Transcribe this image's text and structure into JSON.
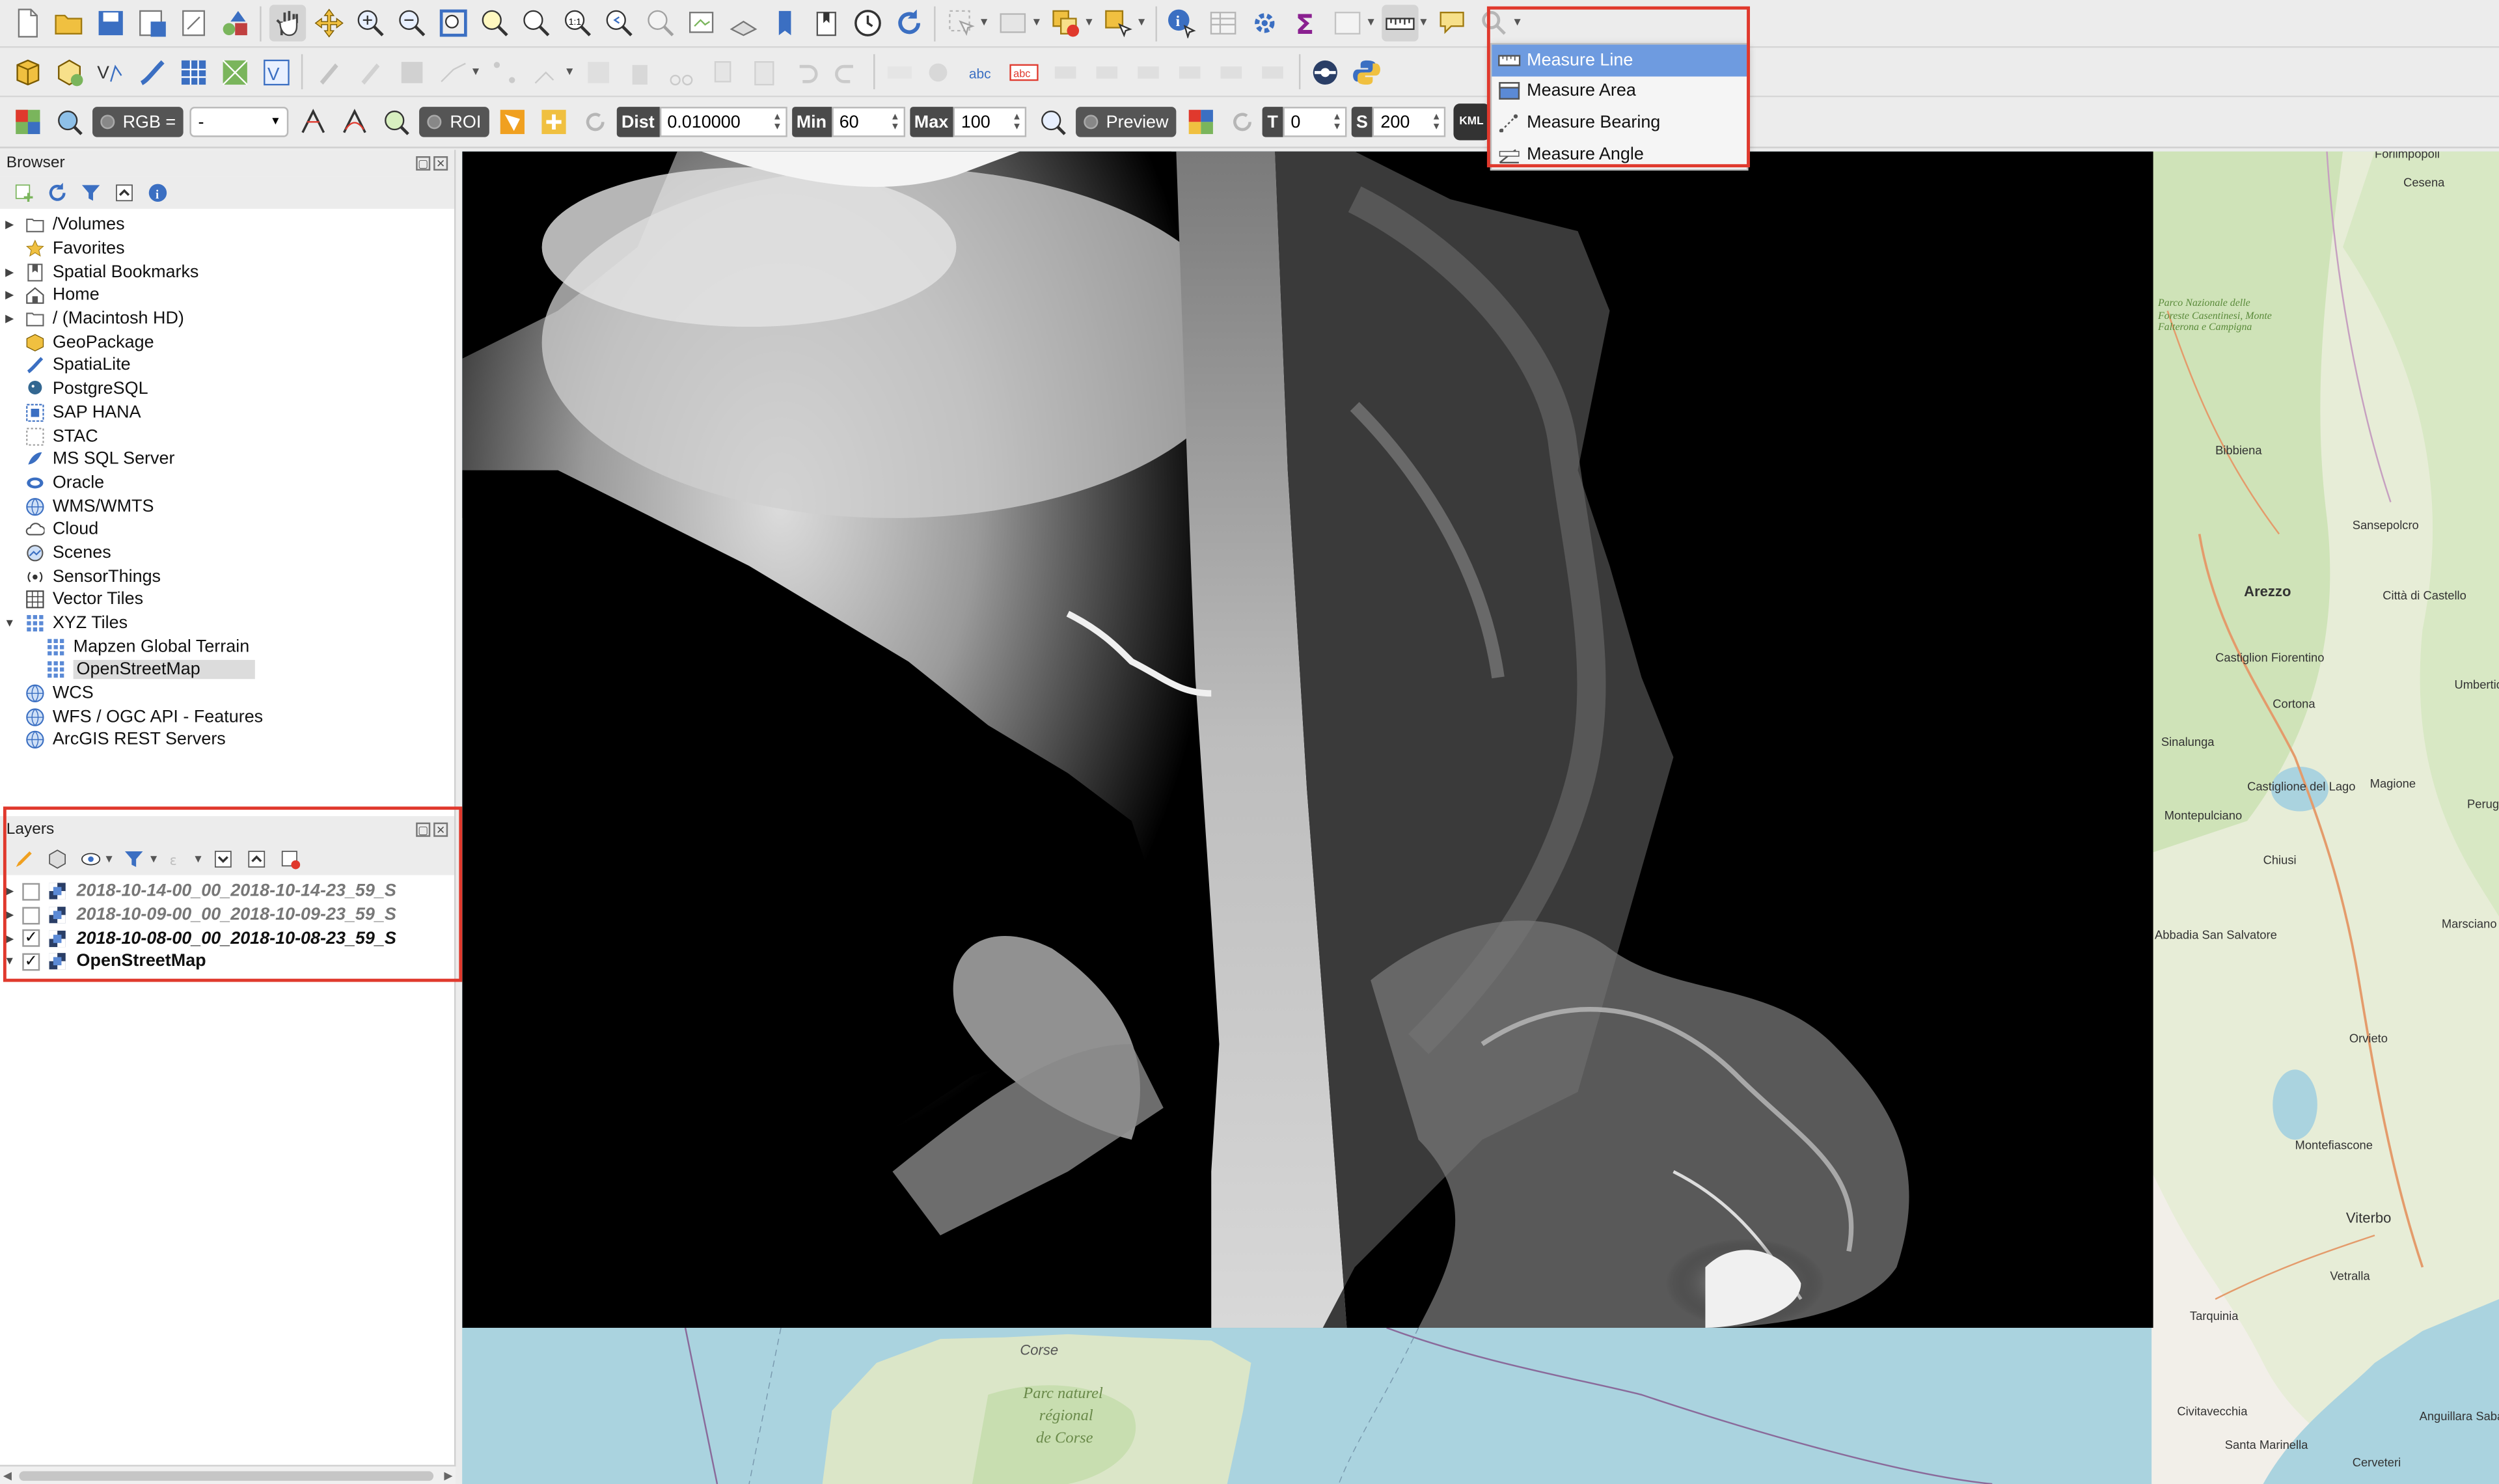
{
  "toolbar3": {
    "rgb_label": "RGB =",
    "rgb_value": "-",
    "roi_label": "ROI",
    "dist_label": "Dist",
    "dist_value": "0.010000",
    "min_label": "Min",
    "min_value": "60",
    "max_label": "Max",
    "max_value": "100",
    "preview_label": "Preview",
    "t_label": "T",
    "t_value": "0",
    "s_label": "S",
    "s_value": "200",
    "kml_label": "KML"
  },
  "measure_menu": {
    "items": [
      {
        "label": "Measure Line",
        "icon": "measure-line-icon",
        "highlighted": true
      },
      {
        "label": "Measure Area",
        "icon": "measure-area-icon"
      },
      {
        "label": "Measure Bearing",
        "icon": "measure-bearing-icon"
      },
      {
        "label": "Measure Angle",
        "icon": "measure-angle-icon"
      }
    ]
  },
  "browser": {
    "title": "Browser",
    "items": [
      {
        "label": "/Volumes",
        "icon": "folder-icon",
        "expandable": true
      },
      {
        "label": "Favorites",
        "icon": "star-icon",
        "expandable": false
      },
      {
        "label": "Spatial Bookmarks",
        "icon": "bookmark-icon",
        "expandable": true
      },
      {
        "label": "Home",
        "icon": "home-icon",
        "expandable": true
      },
      {
        "label": "/ (Macintosh HD)",
        "icon": "folder-icon",
        "expandable": true
      },
      {
        "label": "GeoPackage",
        "icon": "geopackage-icon",
        "expandable": false
      },
      {
        "label": "SpatiaLite",
        "icon": "spatialite-icon",
        "expandable": false
      },
      {
        "label": "PostgreSQL",
        "icon": "postgresql-icon",
        "expandable": false
      },
      {
        "label": "SAP HANA",
        "icon": "sap-hana-icon",
        "expandable": false
      },
      {
        "label": "STAC",
        "icon": "stac-icon",
        "expandable": false
      },
      {
        "label": "MS SQL Server",
        "icon": "mssql-icon",
        "expandable": false
      },
      {
        "label": "Oracle",
        "icon": "oracle-icon",
        "expandable": false
      },
      {
        "label": "WMS/WMTS",
        "icon": "globe-icon",
        "expandable": false
      },
      {
        "label": "Cloud",
        "icon": "cloud-icon",
        "expandable": false
      },
      {
        "label": "Scenes",
        "icon": "scenes-icon",
        "expandable": false
      },
      {
        "label": "SensorThings",
        "icon": "sensor-icon",
        "expandable": false
      },
      {
        "label": "Vector Tiles",
        "icon": "vector-tiles-icon",
        "expandable": false
      },
      {
        "label": "XYZ Tiles",
        "icon": "xyz-tiles-icon",
        "expandable": true,
        "expanded": true
      },
      {
        "label": "Mapzen Global Terrain",
        "icon": "xyz-tiles-icon",
        "child": true
      },
      {
        "label": "OpenStreetMap",
        "icon": "xyz-tiles-icon",
        "child": true,
        "selected": true
      },
      {
        "label": "WCS",
        "icon": "globe-icon",
        "expandable": false
      },
      {
        "label": "WFS / OGC API - Features",
        "icon": "globe-icon",
        "expandable": false
      },
      {
        "label": "ArcGIS REST Servers",
        "icon": "globe-icon",
        "expandable": false
      }
    ]
  },
  "layers": {
    "title": "Layers",
    "items": [
      {
        "label": "2018-10-14-00_00_2018-10-14-23_59_S",
        "checked": false
      },
      {
        "label": "2018-10-09-00_00_2018-10-09-23_59_S",
        "checked": false
      },
      {
        "label": "2018-10-08-00_00_2018-10-08-23_59_S",
        "checked": true
      },
      {
        "label": "OpenStreetMap",
        "checked": true
      }
    ]
  },
  "map": {
    "labels": [
      {
        "text": "Corse"
      },
      {
        "text": "Parc naturel"
      },
      {
        "text": "régional"
      },
      {
        "text": "de Corse"
      },
      {
        "text": "Cesena"
      },
      {
        "text": "Bibbiena"
      },
      {
        "text": "Sansepolcro"
      },
      {
        "text": "Arezzo"
      },
      {
        "text": "Città di Castello"
      },
      {
        "text": "Castiglion Fiorentino"
      },
      {
        "text": "Cortona"
      },
      {
        "text": "Sinalunga"
      },
      {
        "text": "Castiglione del Lago"
      },
      {
        "text": "Magione"
      },
      {
        "text": "Montepulciano"
      },
      {
        "text": "Chiusi"
      },
      {
        "text": "Abbadia San Salvatore"
      },
      {
        "text": "Orvieto"
      },
      {
        "text": "Montefiascone"
      },
      {
        "text": "Viterbo"
      },
      {
        "text": "Tarquinia"
      },
      {
        "text": "Vetralla"
      },
      {
        "text": "Civitavecchia"
      },
      {
        "text": "Anguillara Sabazia"
      },
      {
        "text": "Santa Marinella"
      },
      {
        "text": "Cerveteri"
      },
      {
        "text": "Parco Nazionale delle Foreste Casentinesi, Monte Falterona e Campigna"
      },
      {
        "text": "Perugia"
      },
      {
        "text": "Umbertide"
      },
      {
        "text": "Marsciano"
      },
      {
        "text": "Forlimpopoli"
      }
    ]
  },
  "colors": {
    "accent_highlight": "#6e9be0",
    "annotation_red": "#e0392d",
    "sea": "#aad3df",
    "land": "#f2efe9"
  }
}
